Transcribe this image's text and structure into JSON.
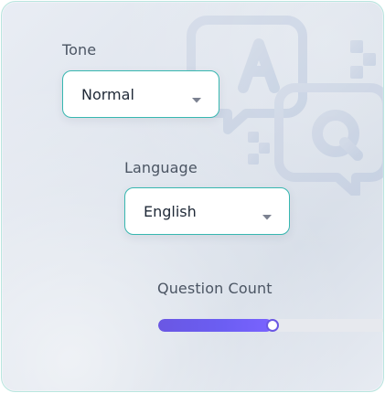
{
  "form": {
    "tone": {
      "label": "Tone",
      "value": "Normal"
    },
    "language": {
      "label": "Language",
      "value": "English"
    },
    "question_count": {
      "label": "Question Count",
      "progress_fraction": 0.48
    }
  },
  "colors": {
    "accent_border": "#37b7b0",
    "slider_fill": "#6a57e3"
  },
  "icons": {
    "dropdown": "chevron-down-icon",
    "watermark": "chat-bubbles-qa-icon"
  }
}
